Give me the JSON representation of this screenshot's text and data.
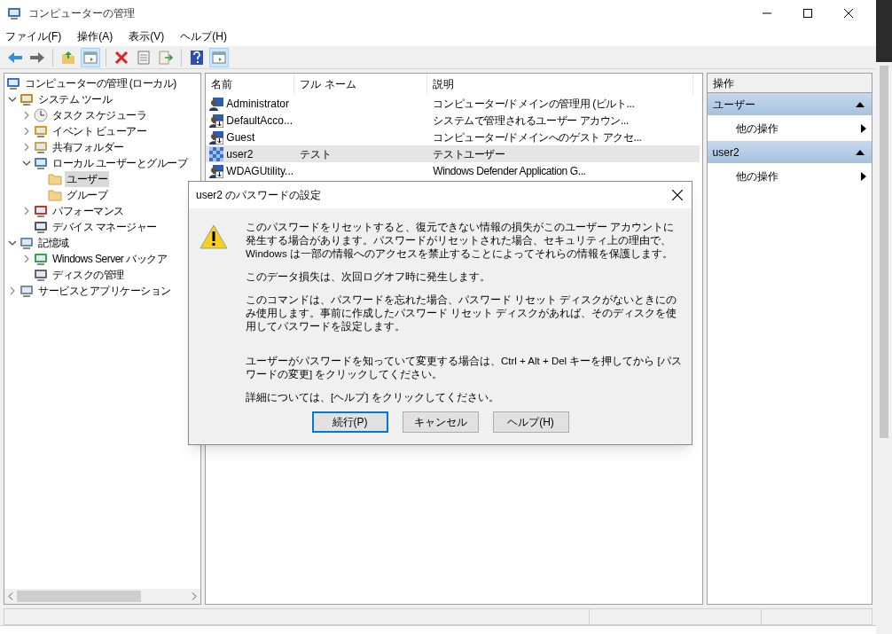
{
  "window": {
    "title": "コンピューターの管理"
  },
  "menu": [
    "ファイル(F)",
    "操作(A)",
    "表示(V)",
    "ヘルプ(H)"
  ],
  "toolbar": [
    {
      "kind": "back",
      "pressed": false
    },
    {
      "kind": "forward",
      "pressed": false
    },
    {
      "kind": "sep"
    },
    {
      "kind": "up",
      "pressed": false
    },
    {
      "kind": "tree",
      "pressed": true
    },
    {
      "kind": "sep"
    },
    {
      "kind": "delete",
      "pressed": false
    },
    {
      "kind": "properties",
      "pressed": false
    },
    {
      "kind": "export",
      "pressed": false
    },
    {
      "kind": "sep"
    },
    {
      "kind": "help",
      "pressed": false
    },
    {
      "kind": "action",
      "pressed": true
    }
  ],
  "tree": [
    {
      "label": "コンピューターの管理 (ローカル)",
      "kind": "computer",
      "selected": false,
      "children": [
        {
          "label": "システム ツール",
          "kind": "tools",
          "expanded": true,
          "selected": false,
          "children": [
            {
              "label": "タスク スケジューラ",
              "kind": "clock",
              "expanded": false,
              "selected": false
            },
            {
              "label": "イベント ビューアー",
              "kind": "event",
              "expanded": false,
              "selected": false
            },
            {
              "label": "共有フォルダー",
              "kind": "share",
              "expanded": false,
              "selected": false
            },
            {
              "label": "ローカル ユーザーとグループ",
              "kind": "users",
              "expanded": true,
              "selected": false,
              "children": [
                {
                  "label": "ユーザー",
                  "kind": "folder",
                  "selected": true
                },
                {
                  "label": "グループ",
                  "kind": "folder",
                  "selected": false
                }
              ]
            },
            {
              "label": "パフォーマンス",
              "kind": "perf",
              "expanded": false,
              "selected": false
            },
            {
              "label": "デバイス マネージャー",
              "kind": "device",
              "selected": false
            }
          ]
        },
        {
          "label": "記憶域",
          "kind": "storage",
          "expanded": true,
          "selected": false,
          "children": [
            {
              "label": "Windows Server バックア",
              "kind": "backup",
              "expanded": false,
              "selected": false
            },
            {
              "label": "ディスクの管理",
              "kind": "disk",
              "selected": false
            }
          ]
        },
        {
          "label": "サービスとアプリケーション",
          "kind": "services",
          "expanded": false,
          "selected": false
        }
      ]
    }
  ],
  "table": {
    "columns": [
      "名前",
      "フル ネーム",
      "説明"
    ],
    "rows": [
      {
        "kind": "user",
        "name": "Administrator",
        "full_name": "",
        "description": "コンピューター/ドメインの管理用 (ビルト...",
        "selected": false
      },
      {
        "kind": "disabled",
        "name": "DefaultAcco...",
        "full_name": "",
        "description": "システムで管理されるユーザー アカウン...",
        "selected": false
      },
      {
        "kind": "disabled",
        "name": "Guest",
        "full_name": "",
        "description": "コンピューター/ドメインへのゲスト アクセ...",
        "selected": false
      },
      {
        "kind": "checkered",
        "name": "user2",
        "full_name": "テスト",
        "description": "テストユーザー",
        "selected": true
      },
      {
        "kind": "disabled",
        "name": "WDAGUtility...",
        "full_name": "",
        "description": "Windows Defender Application G...",
        "selected": false
      }
    ]
  },
  "actions": {
    "title": "操作",
    "sections": [
      {
        "title": "ユーザー",
        "expanded": true,
        "items": [
          "他の操作"
        ]
      },
      {
        "title": "user2",
        "expanded": true,
        "items": [
          "他の操作"
        ]
      }
    ]
  },
  "dialog": {
    "title": "user2 のパスワードの設定",
    "paragraphs": [
      "このパスワードをリセットすると、復元できない情報の損失がこのユーザー アカウントに発生する場合があります。パスワードがリセットされた場合、セキュリティ上の理由で、Windows は一部の情報へのアクセスを禁止することによってそれらの情報を保護します。",
      "このデータ損失は、次回ログオフ時に発生します。",
      "このコマンドは、パスワードを忘れた場合、パスワード リセット ディスクがないときにのみ使用します。事前に作成したパスワード リセット ディスクがあれば、そのディスクを使用してパスワードを設定します。",
      "ユーザーがパスワードを知っていて変更する場合は、Ctrl + Alt + Del キーを押してから [パスワードの変更] をクリックしてください。",
      "詳細については、[ヘルプ] をクリックしてください。"
    ],
    "buttons": [
      {
        "label": "続行(P)",
        "default": true
      },
      {
        "label": "キャンセル",
        "default": false
      },
      {
        "label": "ヘルプ(H)",
        "default": false
      }
    ]
  }
}
